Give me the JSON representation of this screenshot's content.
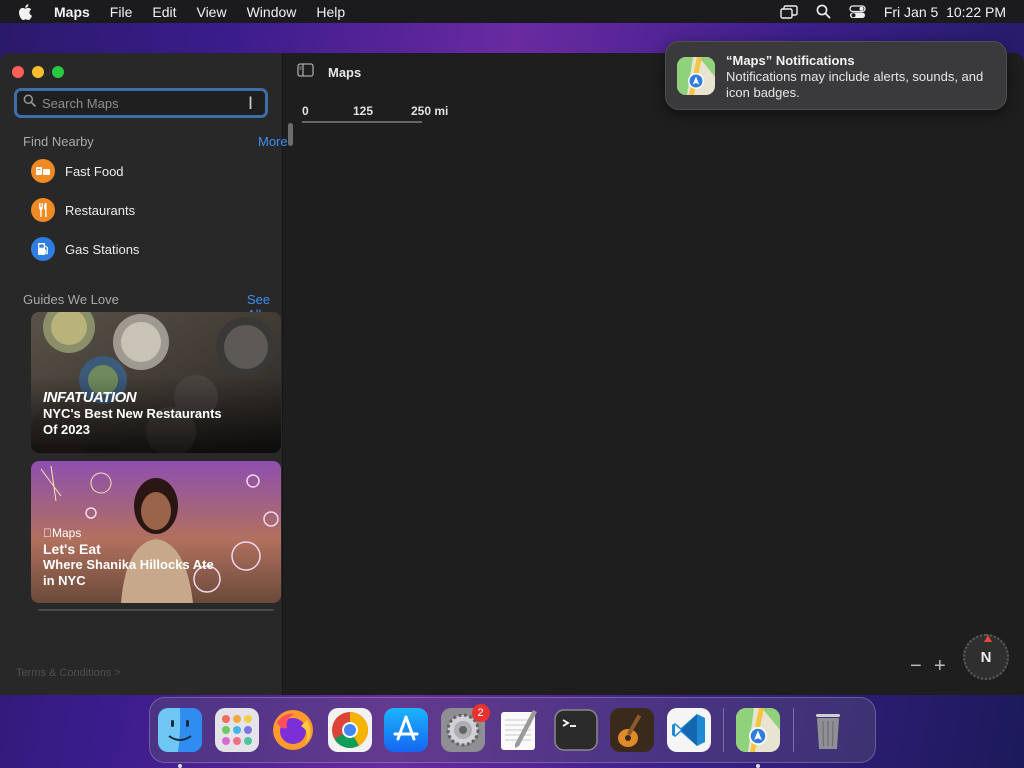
{
  "menubar": {
    "app_name": "Maps",
    "items": [
      "File",
      "Edit",
      "View",
      "Window",
      "Help"
    ],
    "datetime": "Fri Jan 5  10:22 PM"
  },
  "window": {
    "toolbar_title": "Maps",
    "search": {
      "placeholder": "Search Maps"
    },
    "find_nearby": {
      "heading": "Find Nearby",
      "more_label": "More",
      "items": [
        {
          "label": "Fast Food",
          "color": "#f08a24"
        },
        {
          "label": "Restaurants",
          "color": "#f08a24"
        },
        {
          "label": "Gas Stations",
          "color": "#2f7de0"
        }
      ]
    },
    "guides": {
      "heading": "Guides We Love",
      "see_all_label": "See All",
      "cards": [
        {
          "brand": "INFATUATION",
          "title_line1": "NYC's Best New Restaurants",
          "title_line2": "Of 2023"
        },
        {
          "brand": "Maps",
          "subtitle": "Let's Eat",
          "title_line1": "Where Shanika Hillocks Ate",
          "title_line2": "in NYC"
        }
      ]
    },
    "terms_label": "Terms & Conditions >",
    "scale": {
      "labels": [
        "0",
        "125",
        "250 mi"
      ]
    },
    "zoom_out_label": "−",
    "zoom_in_label": "+",
    "compass_label": "N"
  },
  "notification": {
    "title": "“Maps” Notifications",
    "body": "Notifications may include alerts, sounds, and icon badges."
  },
  "dock": {
    "settings_badge": "2"
  },
  "colors": {
    "accent": "#3d8ff5",
    "search_focus": "#3f6fa8"
  }
}
